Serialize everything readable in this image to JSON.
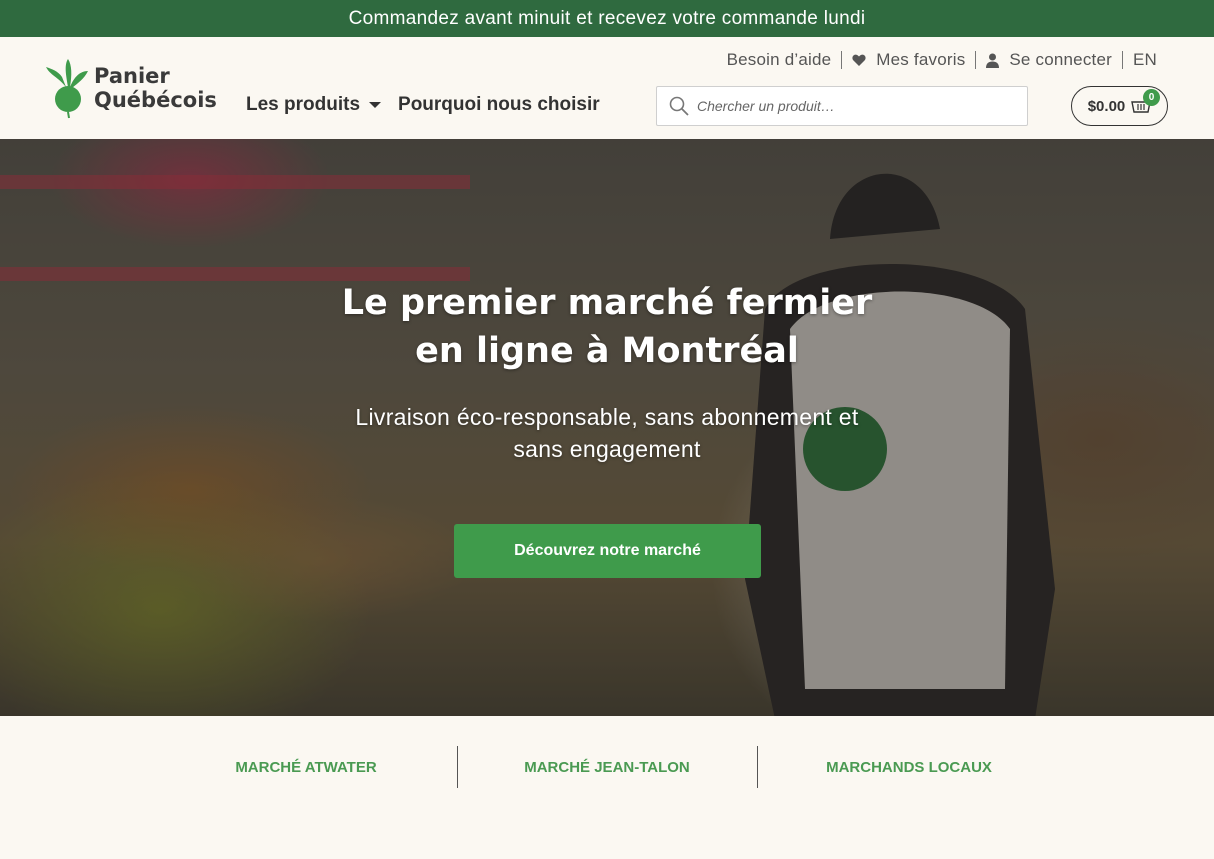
{
  "announcement": "Commandez avant minuit et recevez votre commande lundi",
  "brand": {
    "line1": "Panier",
    "line2": "Québécois",
    "color": "#3f9b4b"
  },
  "nav": [
    {
      "label": "Les produits",
      "has_dropdown": true
    },
    {
      "label": "Pourquoi nous choisir",
      "has_dropdown": false
    }
  ],
  "utility": {
    "help": "Besoin d’aide",
    "favorites": "Mes favoris",
    "login": "Se connecter",
    "language": "EN"
  },
  "search": {
    "placeholder": "Chercher un produit…",
    "icon": "search-icon"
  },
  "cart": {
    "amount": "$0.00",
    "count": "0",
    "icon": "basket-icon"
  },
  "hero": {
    "title_line1": "Le premier marché fermier",
    "title_line2": "en ligne à Montréal",
    "subtitle_line1": "Livraison éco-responsable, sans abonnement et",
    "subtitle_line2": "sans engagement",
    "cta": "Découvrez notre marché"
  },
  "markets": [
    "MARCHÉ ATWATER",
    "MARCHÉ JEAN-TALON",
    "MARCHANDS LOCAUX"
  ],
  "colors": {
    "topbar": "#2f6a3f",
    "accent": "#3f9b4b",
    "background": "#fbf8f2"
  }
}
